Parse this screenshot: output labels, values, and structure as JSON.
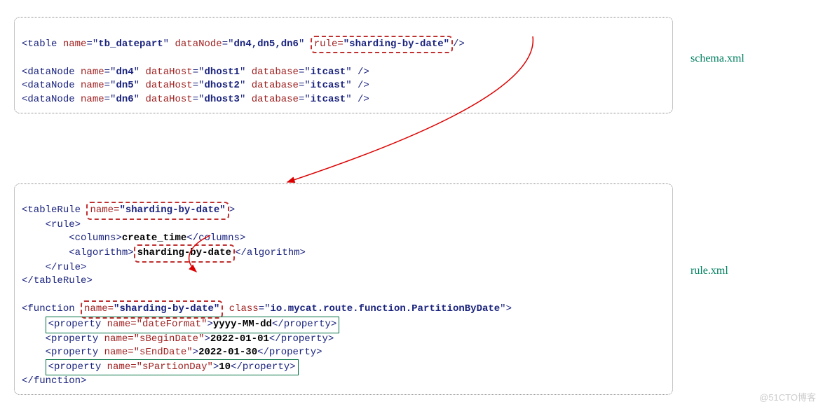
{
  "labels": {
    "schema": "schema.xml",
    "rule": "rule.xml"
  },
  "schema": {
    "table": {
      "name": "tb_datepart",
      "dataNode": "dn4,dn5,dn6",
      "ruleAttr": "rule=",
      "ruleVal": "\"sharding-by-date\""
    },
    "nodes": [
      {
        "name": "dn4",
        "host": "dhost1",
        "db": "itcast"
      },
      {
        "name": "dn5",
        "host": "dhost2",
        "db": "itcast"
      },
      {
        "name": "dn6",
        "host": "dhost3",
        "db": "itcast"
      }
    ]
  },
  "rule": {
    "tableRule": {
      "nameAttr": "name=",
      "nameVal": "\"sharding-by-date\""
    },
    "columns": "create_time",
    "algorithm": "sharding-by-date",
    "function": {
      "nameAttr": "name=",
      "nameVal": "\"sharding-by-date\"",
      "class": "io.mycat.route.function.PartitionByDate"
    },
    "props": [
      {
        "nameAttr": "name=\"dateFormat\"",
        "val": "yyyy-MM-dd"
      },
      {
        "nameAttr": "name=\"sBeginDate\"",
        "val": "2022-01-01"
      },
      {
        "nameAttr": "name=\"sEndDate\"",
        "val": "2022-01-30"
      },
      {
        "nameAttr": "name=\"sPartionDay\"",
        "val": "10"
      }
    ]
  },
  "watermark": "@51CTO博客"
}
